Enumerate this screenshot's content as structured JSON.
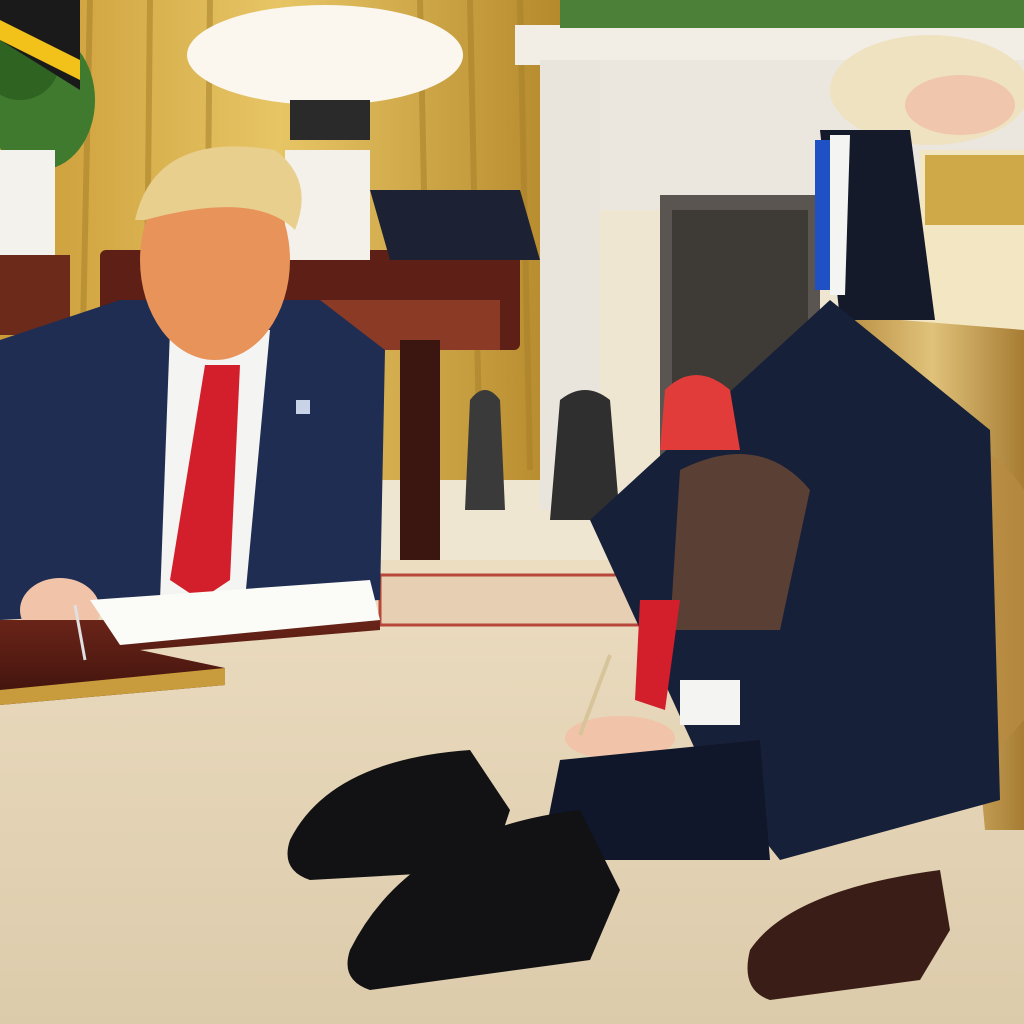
{
  "scene": {
    "kind": "photo-illustration",
    "text_present": false
  },
  "palette": {
    "curtain_gold": "#d9b04c",
    "curtain_shadow": "#a8802a",
    "wall_cream": "#f1ead9",
    "fireplace_white": "#eeeae2",
    "carpet_cream": "#e7d8bd",
    "carpet_border_red": "#b8463a",
    "desk_mahogany": "#5a1d14",
    "suit_navy": "#1f2d52",
    "suit_dark": "#141b2c",
    "tie_red": "#d21f2b",
    "shirt_white": "#f4f4f2",
    "skin_orange": "#e8935a",
    "hair_blond": "#e8cf8e",
    "shoe_black": "#121214",
    "shoe_brown": "#3a1d16",
    "armchair_gold": "#c9a45a",
    "plant_green": "#3f7a2e"
  }
}
